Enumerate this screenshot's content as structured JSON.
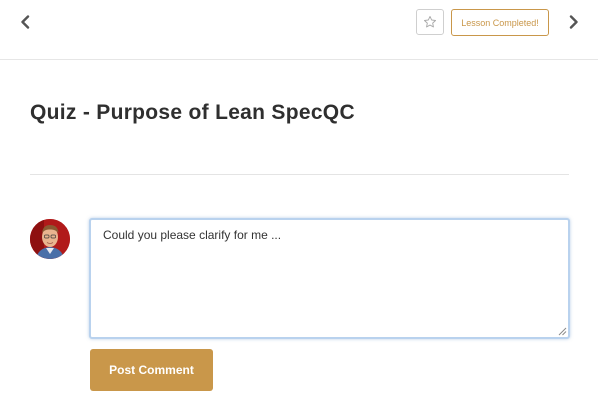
{
  "header": {
    "prev_icon": "chevron-left-icon",
    "next_icon": "chevron-right-icon",
    "favorite_icon": "star-outline-icon",
    "complete_label": "Lesson Completed!"
  },
  "lesson": {
    "title": "Quiz - Purpose of Lean SpecQC"
  },
  "comment": {
    "avatar_icon": "user-avatar",
    "value": "Could you please clarify for me ...",
    "submit_label": "Post Comment"
  },
  "colors": {
    "accent": "#c9974a",
    "title": "#2f2f2f",
    "focus_border": "#b9d2ee"
  }
}
